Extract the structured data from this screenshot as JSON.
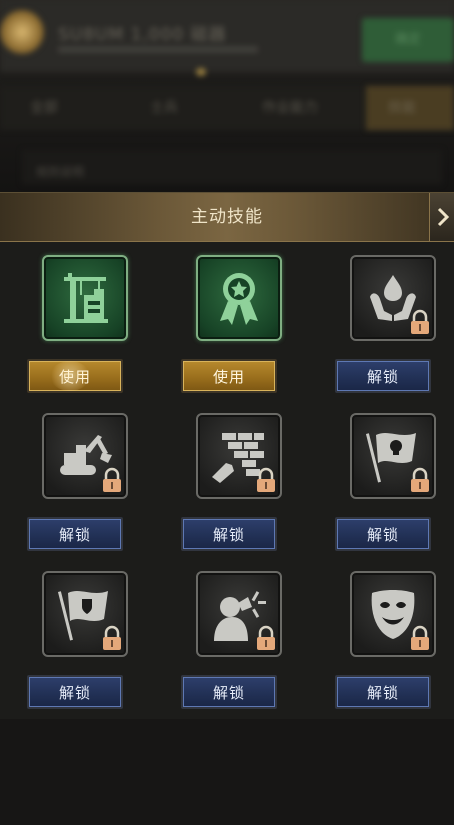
{
  "background": {
    "banner_title": "SU8UM 1,000 磁器",
    "confirm_label": "确定",
    "tabs": [
      "全部",
      "士兵",
      "作业能力",
      "技能"
    ],
    "row_text": "规则说明"
  },
  "panel": {
    "title": "主动技能",
    "skills": [
      {
        "icon": "construction-crane-icon",
        "button": "使用",
        "state": "active",
        "locked": false
      },
      {
        "icon": "ribbon-medal-icon",
        "button": "使用",
        "state": "active",
        "locked": false
      },
      {
        "icon": "hands-droplet-icon",
        "button": "解锁",
        "state": "locked",
        "locked": true
      },
      {
        "icon": "excavator-icon",
        "button": "解锁",
        "state": "locked",
        "locked": true
      },
      {
        "icon": "brick-wall-icon",
        "button": "解锁",
        "state": "locked",
        "locked": true
      },
      {
        "icon": "skull-flag-icon",
        "button": "解锁",
        "state": "locked",
        "locked": true
      },
      {
        "icon": "shield-flag-icon",
        "button": "解锁",
        "state": "locked",
        "locked": true
      },
      {
        "icon": "shouting-person-icon",
        "button": "解锁",
        "state": "locked",
        "locked": true
      },
      {
        "icon": "theater-mask-icon",
        "button": "解锁",
        "state": "locked",
        "locked": true
      }
    ]
  },
  "colors": {
    "use_button": "#9a6f1d",
    "unlock_button": "#223156",
    "active_icon_bg": "#1f5a32",
    "header_gold": "#6b5838"
  }
}
